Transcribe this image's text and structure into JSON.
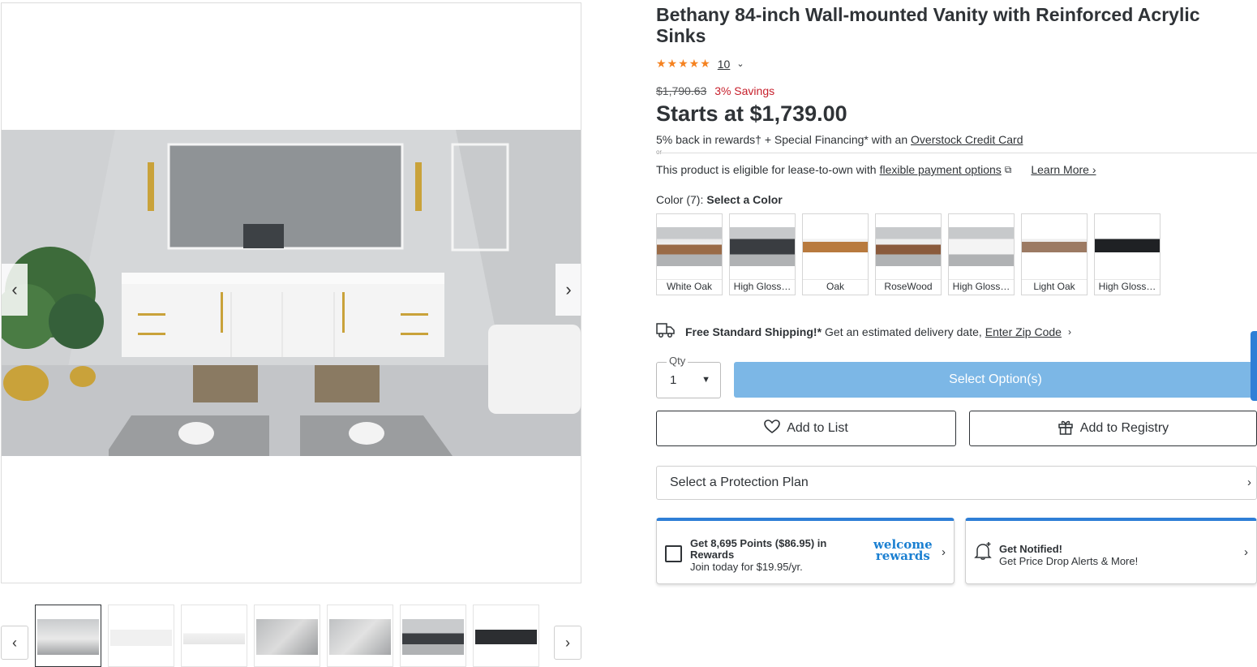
{
  "gallery": {
    "prev_arrow": "‹",
    "next_arrow": "›",
    "thumb_prev": "‹",
    "thumb_next": "›"
  },
  "product": {
    "title": "Bethany 84-inch Wall-mounted Vanity with Reinforced Acrylic Sinks",
    "stars": "★★★★★",
    "rating_count": "10",
    "rating_chevron": "⌄",
    "original_price": "$1,790.63",
    "savings": "3% Savings",
    "starts_at": "Starts at $1,739.00",
    "rewards_text": "5% back in rewards† + Special Financing* with an",
    "rewards_link": "Overstock Credit Card",
    "or_text": "or",
    "lease_text": "This product is eligible for lease-to-own with",
    "lease_link": "flexible payment options",
    "learn_more": "Learn More ›"
  },
  "color": {
    "label": "Color (7):",
    "prompt": "Select a Color",
    "options": [
      "White Oak",
      "High Gloss…",
      "Oak",
      "RoseWood",
      "High Gloss…",
      "Light Oak",
      "High Gloss…"
    ]
  },
  "shipping": {
    "bold": "Free Standard Shipping!*",
    "text": "Get an estimated delivery date,",
    "link": "Enter Zip Code",
    "chevron": "›"
  },
  "purchase": {
    "qty_label": "Qty",
    "qty_value": "1",
    "select_options": "Select Option(s)",
    "add_to_list": "Add to List",
    "add_to_registry": "Add to Registry",
    "protection_plan": "Select a Protection Plan"
  },
  "rewards_card": {
    "title": "Get 8,695 Points ($86.95) in Rewards",
    "subtitle": "Join today for $19.95/yr.",
    "logo_line1": "welcome",
    "logo_line2": "rewards"
  },
  "notify_card": {
    "title": "Get Notified!",
    "subtitle": "Get Price Drop Alerts & More!"
  },
  "colors": {
    "accent": "#2f7fd6",
    "select_button": "#7cb7e6",
    "star": "#f58220",
    "savings": "#c7202c"
  }
}
